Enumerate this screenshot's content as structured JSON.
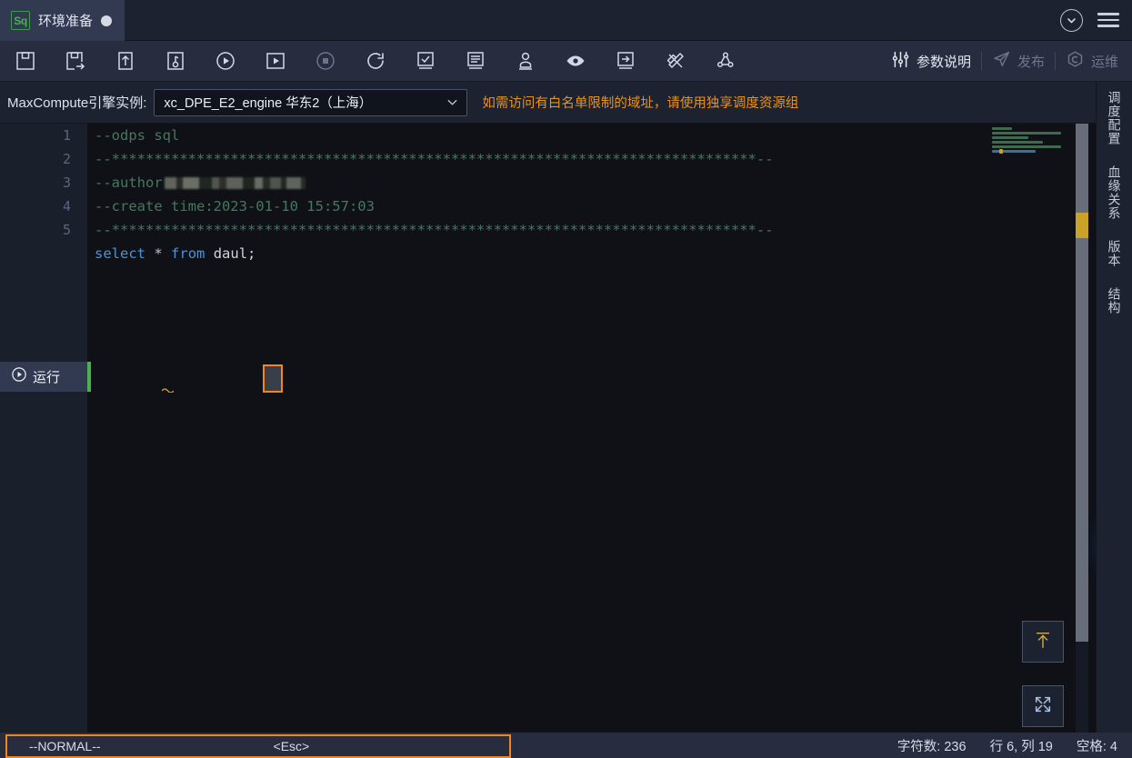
{
  "tab": {
    "icon_label": "Sq",
    "title": "环境准备",
    "modified_indicator": "●"
  },
  "window_controls": {
    "collapse_icon": "chevron-down-circle-icon",
    "menu_icon": "hamburger-menu-icon"
  },
  "toolbar": {
    "icons": [
      {
        "name": "save-icon",
        "title": "保存"
      },
      {
        "name": "save-as-icon",
        "title": "另存为"
      },
      {
        "name": "submit-icon",
        "title": "提交"
      },
      {
        "name": "steal-lock-icon",
        "title": "偷锁编辑"
      },
      {
        "name": "run-icon",
        "title": "运行"
      },
      {
        "name": "run-with-params-icon",
        "title": "高级运行"
      },
      {
        "name": "stop-icon",
        "title": "停止",
        "disabled": true
      },
      {
        "name": "reload-icon",
        "title": "重新加载"
      },
      {
        "name": "precheck-icon",
        "title": "预检查"
      },
      {
        "name": "format-icon",
        "title": "格式化"
      },
      {
        "name": "deploy-user-icon",
        "title": "执行人"
      },
      {
        "name": "preview-icon",
        "title": "预览"
      },
      {
        "name": "import-icon",
        "title": "导入"
      },
      {
        "name": "cost-estimate-icon",
        "title": "成本估计"
      },
      {
        "name": "lineage-icon",
        "title": "血缘"
      }
    ],
    "right_buttons": [
      {
        "name": "param-desc-button",
        "label": "参数说明",
        "icon": "sliders-icon",
        "disabled": false
      },
      {
        "name": "publish-button",
        "label": "发布",
        "icon": "send-icon",
        "disabled": true
      },
      {
        "name": "ops-button",
        "label": "运维",
        "icon": "ops-icon",
        "disabled": true
      }
    ]
  },
  "engine_bar": {
    "label": "MaxCompute引擎实例:",
    "selected": "xc_DPE_E2_engine 华东2（上海）",
    "caret_icon": "chevron-down-icon",
    "warning": "如需访问有白名单限制的域址，请使用独享调度资源组",
    "warning_color": "#e8921f"
  },
  "editor": {
    "line_numbers": [
      "1",
      "2",
      "3",
      "4",
      "5"
    ],
    "lines": [
      {
        "num": "1",
        "type": "comment",
        "text": "--odps sql"
      },
      {
        "num": "2",
        "type": "comment",
        "text": "--****************************************************************************--"
      },
      {
        "num": "3",
        "type": "comment",
        "text": "--author",
        "redacted": true
      },
      {
        "num": "4",
        "type": "comment",
        "text": "--create time:2023-01-10 15:57:03"
      },
      {
        "num": "5",
        "type": "comment",
        "text": "--****************************************************************************--"
      }
    ],
    "active_line": {
      "num": "6",
      "kw_select": "select",
      "star": "*",
      "kw_from": "from",
      "table": "daul",
      "terminator": ";"
    },
    "run_button": {
      "label": "运行",
      "icon": "play-circle-icon"
    },
    "colors": {
      "comment": "#44795b",
      "keyword": "#4b93d8",
      "identifier": "#cdd4e2",
      "cursor_outline": "#f2861e",
      "background": "#0f1117"
    }
  },
  "side_panel": {
    "items": [
      {
        "name": "sidebar-item-schedule-config",
        "label": "调度配置"
      },
      {
        "name": "sidebar-item-lineage",
        "label": "血缘关系"
      },
      {
        "name": "sidebar-item-version",
        "label": "版本"
      },
      {
        "name": "sidebar-item-structure",
        "label": "结构"
      }
    ]
  },
  "floating": {
    "scroll_top_icon": "scroll-to-top-icon",
    "expand_icon": "fullscreen-expand-icon",
    "help_icon": "customer-service-icon"
  },
  "status_bar": {
    "vim_mode": "--NORMAL--",
    "vim_key": "<Esc>",
    "char_count": "字符数: 236",
    "cursor_pos": "行 6, 列 19",
    "indent": "空格: 4"
  }
}
